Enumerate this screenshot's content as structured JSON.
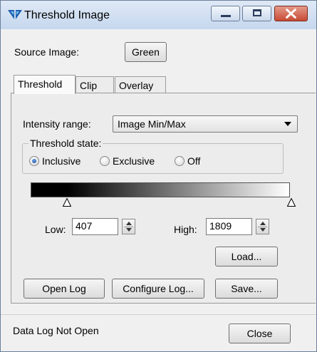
{
  "window": {
    "title": "Threshold Image",
    "icons": {
      "app": "app-logo-icon",
      "minimize": "minimize-icon",
      "maximize": "maximize-icon",
      "close": "close-icon"
    }
  },
  "source": {
    "label": "Source Image:",
    "button": "Green"
  },
  "tabs": [
    {
      "label": "Threshold",
      "active": true
    },
    {
      "label": "Clip",
      "active": false
    },
    {
      "label": "Overlay",
      "active": false
    }
  ],
  "threshold": {
    "intensity_label": "Intensity range:",
    "intensity_value": "Image Min/Max",
    "state_label": "Threshold state:",
    "states": [
      {
        "label": "Inclusive",
        "selected": true
      },
      {
        "label": "Exclusive",
        "selected": false
      },
      {
        "label": "Off",
        "selected": false
      }
    ],
    "low_label": "Low:",
    "low_value": "407",
    "high_label": "High:",
    "high_value": "1809"
  },
  "buttons": {
    "load": "Load...",
    "open_log": "Open Log",
    "configure_log": "Configure Log...",
    "save": "Save...",
    "close": "Close"
  },
  "status": {
    "log": "Data Log Not Open"
  },
  "colors": {
    "title_bar": "#c5d7ee",
    "close_button": "#c74a34",
    "radio_selected": "#1d4f9a",
    "dialog_bg": "#f0f0f0"
  }
}
